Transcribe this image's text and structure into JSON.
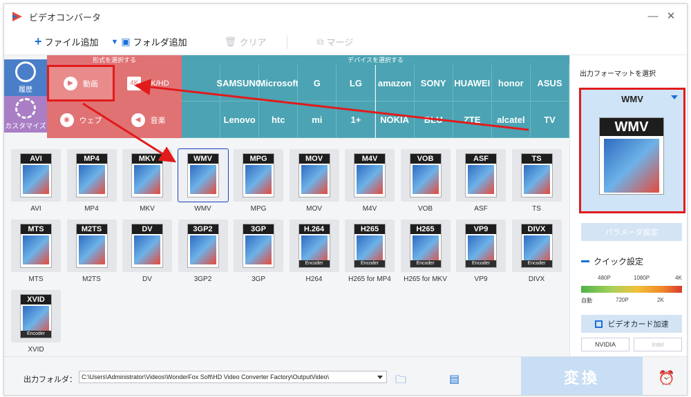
{
  "window": {
    "title": "ビデオコンバータ",
    "minimize": "—",
    "close": "✕"
  },
  "toolbar": {
    "add_file": "ファイル追加",
    "add_folder": "フォルダ追加",
    "clear": "クリア",
    "merge": "マージ"
  },
  "categories": {
    "format_header": "形式を選択する",
    "device_header": "デバイスを選択する",
    "side_tabs": [
      "履歴",
      "カスタマイズ"
    ],
    "media": [
      {
        "label": "動画",
        "icon": "play-icon",
        "highlighted": true
      },
      {
        "label": "4K/HD",
        "icon": "4k-icon",
        "highlighted": false
      },
      {
        "label": "ウェブ",
        "icon": "web-icon",
        "highlighted": false
      },
      {
        "label": "音楽",
        "icon": "music-icon",
        "highlighted": false
      }
    ],
    "brands_row1": [
      "",
      "SAMSUNG",
      "Microsoft",
      "G",
      "LG",
      "amazon",
      "SONY",
      "HUAWEI",
      "honor",
      "ASUS"
    ],
    "brands_row2": [
      "",
      "Lenovo",
      "htc",
      "mi",
      "1+",
      "NOKIA",
      "BLU",
      "ZTE",
      "alcatel",
      "TV"
    ]
  },
  "formats": [
    {
      "band": "AVI",
      "label": "AVI"
    },
    {
      "band": "MP4",
      "label": "MP4"
    },
    {
      "band": "MKV",
      "label": "MKV"
    },
    {
      "band": "WMV",
      "label": "WMV",
      "selected": true
    },
    {
      "band": "MPG",
      "label": "MPG"
    },
    {
      "band": "MOV",
      "label": "MOV"
    },
    {
      "band": "M4V",
      "label": "M4V"
    },
    {
      "band": "VOB",
      "label": "VOB"
    },
    {
      "band": "ASF",
      "label": "ASF"
    },
    {
      "band": "TS",
      "label": "TS"
    },
    {
      "band": "MTS",
      "label": "MTS"
    },
    {
      "band": "M2TS",
      "label": "M2TS"
    },
    {
      "band": "DV",
      "label": "DV"
    },
    {
      "band": "3GP2",
      "label": "3GP2"
    },
    {
      "band": "3GP",
      "label": "3GP"
    },
    {
      "band": "H.264",
      "label": "H264",
      "encoder": "Encoder"
    },
    {
      "band": "H265",
      "label": "H265 for MP4",
      "encoder": "Encoder"
    },
    {
      "band": "H265",
      "label": "H265 for MKV",
      "encoder": "Encoder"
    },
    {
      "band": "VP9",
      "label": "VP9",
      "encoder": "Encoder"
    },
    {
      "band": "DIVX",
      "label": "DIVX",
      "encoder": "Encoder"
    },
    {
      "band": "XVID",
      "label": "XVID",
      "encoder": "Encoder"
    }
  ],
  "right_panel": {
    "title": "出力フォーマットを選択",
    "selected_format": "WMV",
    "param_button": "パラメータ設定",
    "quick_settings": "クイック設定",
    "scale_top": [
      "480P",
      "1080P",
      "4K"
    ],
    "scale_bottom": [
      "自動",
      "720P",
      "2K"
    ],
    "gpu_button": "ビデオカード加速",
    "vendors": [
      "NVIDIA",
      "Intel"
    ]
  },
  "bottom": {
    "output_label": "出力フォルダ：",
    "output_path": "C:\\Users\\Administrator\\Videos\\WonderFox Soft\\HD Video Converter Factory\\OutputVideo\\",
    "convert": "変換"
  },
  "colors": {
    "media_bg": "#e07274",
    "device_bg": "#4ba3b3",
    "accent": "#1a6fd6",
    "annotation": "#e11b1b"
  }
}
